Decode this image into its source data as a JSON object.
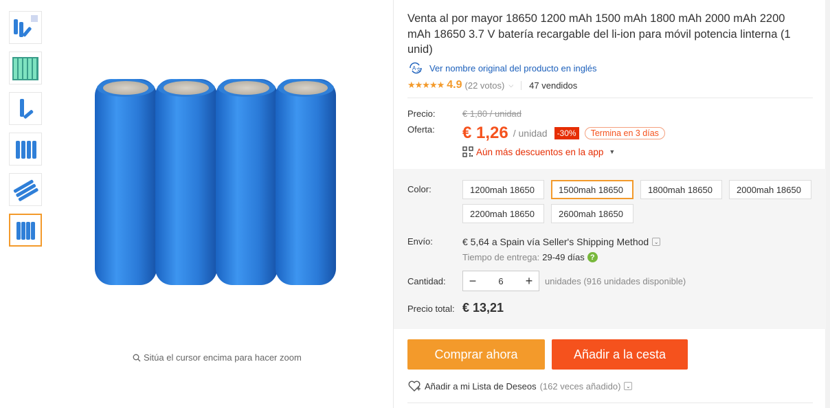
{
  "gallery": {
    "thumbnails": [
      "thumb-1",
      "thumb-2",
      "thumb-3",
      "thumb-4",
      "thumb-5",
      "thumb-6"
    ],
    "active_index": 5,
    "zoom_hint": "Sitúa el cursor encima para hacer zoom"
  },
  "product": {
    "title": "Venta al por mayor 18650 1200 mAh 1500 mAh 1800 mAh 2000 mAh 2200 mAh 18650 3.7 V batería recargable del li-ion para móvil potencia linterna (1 unid)",
    "original_name_link": "Ver nombre original del producto en inglés",
    "rating_stars": 5,
    "rating_score": "4.9",
    "votes": "(22 votos)",
    "sold": "47 vendidos"
  },
  "pricing": {
    "price_label": "Precio:",
    "old_price": "€ 1,80 / unidad",
    "offer_label": "Oferta:",
    "price": "€ 1,26",
    "unit": "/ unidad",
    "discount": "-30%",
    "ends": "Termina en 3 días",
    "app_discount": "Aún más descuentos en la app"
  },
  "options": {
    "color_label": "Color:",
    "colors": [
      "1200mah 18650",
      "1500mah 18650",
      "1800mah 18650",
      "2000mah 18650",
      "2200mah 18650",
      "2600mah 18650"
    ],
    "selected": "1500mah 18650"
  },
  "shipping": {
    "label": "Envío:",
    "method": "€ 5,64 a Spain vía Seller's Shipping Method",
    "delivery_label": "Tiempo de entrega:",
    "delivery_days": "29-49 días"
  },
  "quantity": {
    "label": "Cantidad:",
    "value": "6",
    "availability": "unidades (916 unidades disponible)"
  },
  "total": {
    "label": "Precio total:",
    "value": "€ 13,21"
  },
  "actions": {
    "buy_now": "Comprar ahora",
    "add_to_cart": "Añadir a la cesta",
    "wishlist": "Añadir a mi Lista de Deseos",
    "wishlist_count": "(162 veces añadido)"
  },
  "colors": {
    "accent_orange": "#f39a2b",
    "price_red": "#f5521d",
    "discount_red": "#e62e04",
    "link_blue": "#1b5fbb",
    "battery_blue": "#2f7fd8"
  }
}
